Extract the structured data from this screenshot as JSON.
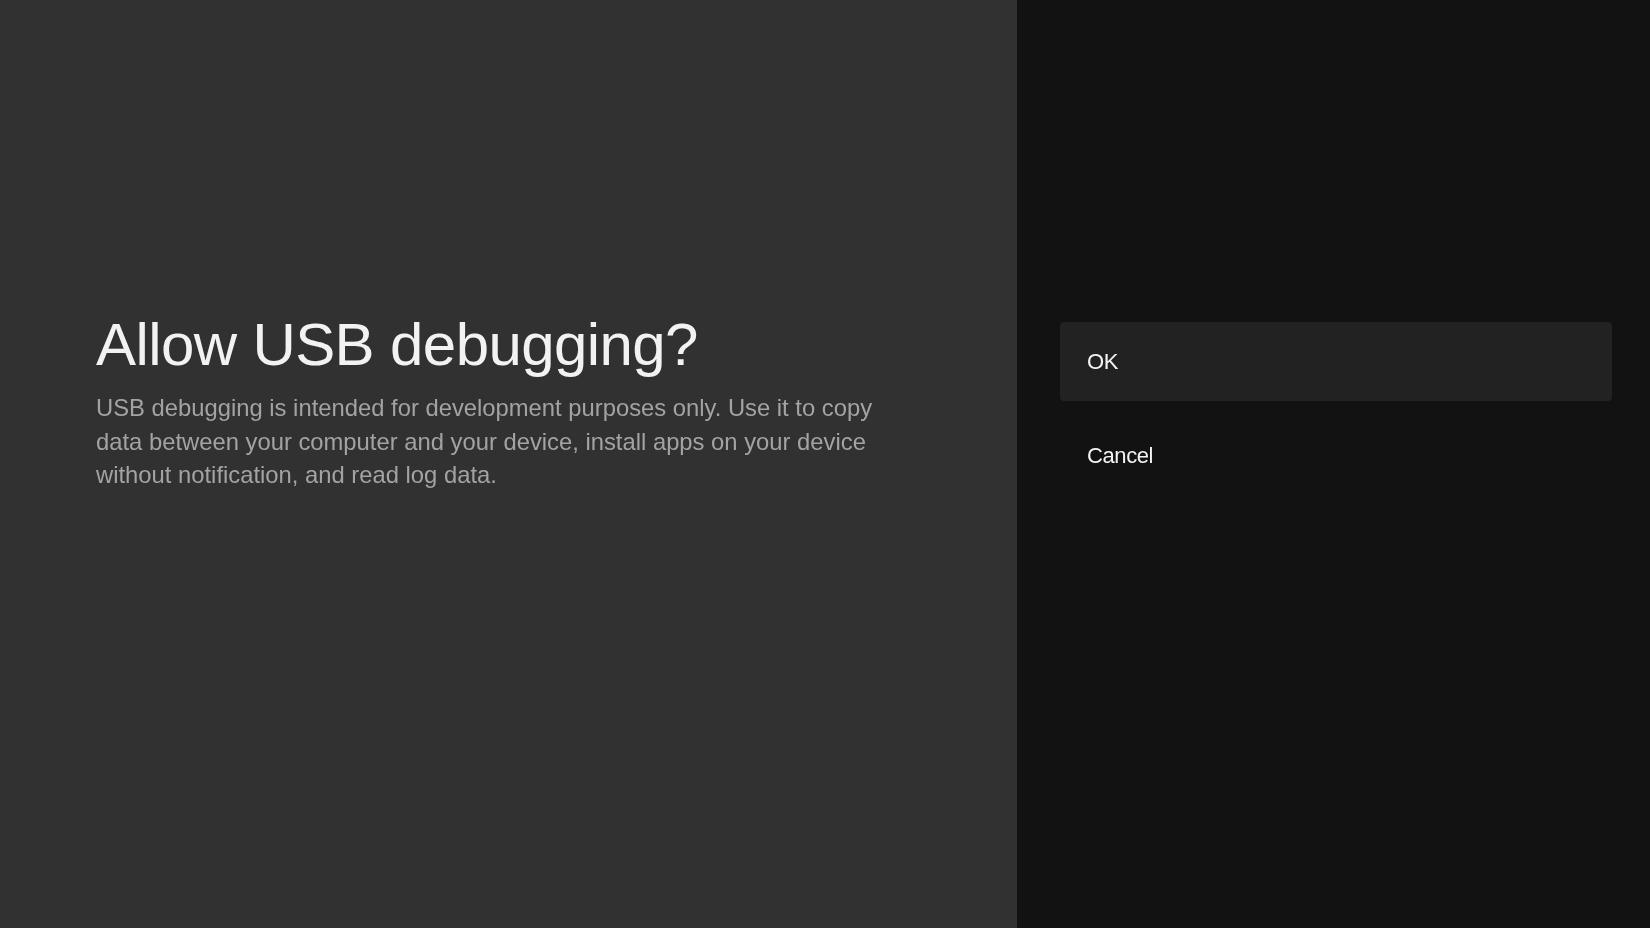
{
  "dialog": {
    "title": "Allow USB debugging?",
    "message": "USB debugging is intended for development purposes only. Use it to copy data between your computer and your device, install apps on your device without notification, and read log data."
  },
  "actions": [
    {
      "label": "OK",
      "selected": true
    },
    {
      "label": "Cancel",
      "selected": false
    }
  ]
}
